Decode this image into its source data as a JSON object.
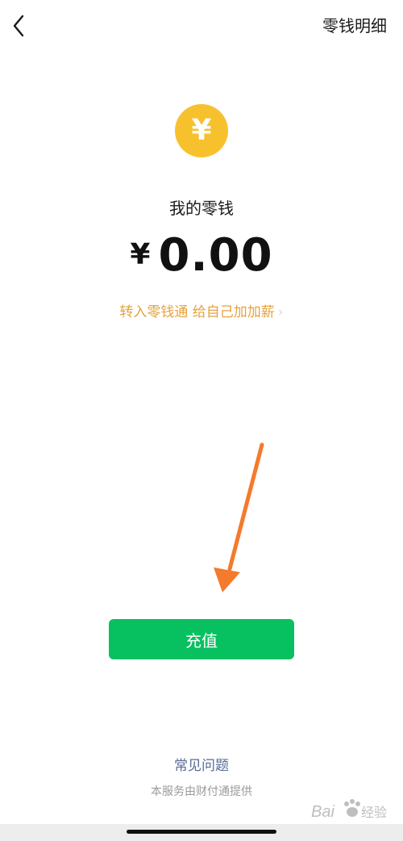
{
  "header": {
    "back_icon": "chevron-left-icon",
    "detail_label": "零钱明细"
  },
  "balance_card": {
    "coin_icon": "yuan-coin-icon",
    "coin_symbol": "¥",
    "coin_color": "#f7c12e",
    "label": "我的零钱",
    "currency": "¥",
    "amount": "0.00"
  },
  "promo": {
    "text": "转入零钱通 给自己加加薪",
    "chevron": "›",
    "color": "#e6a23c"
  },
  "annotation": {
    "arrow_icon": "orange-arrow-annotation",
    "color": "#f47a2c"
  },
  "actions": {
    "recharge_label": "充值",
    "recharge_color": "#07c160"
  },
  "footer": {
    "faq_label": "常见问题",
    "provider_text": "本服务由财付通提供"
  },
  "watermark": {
    "text": "Bai du 经验"
  }
}
